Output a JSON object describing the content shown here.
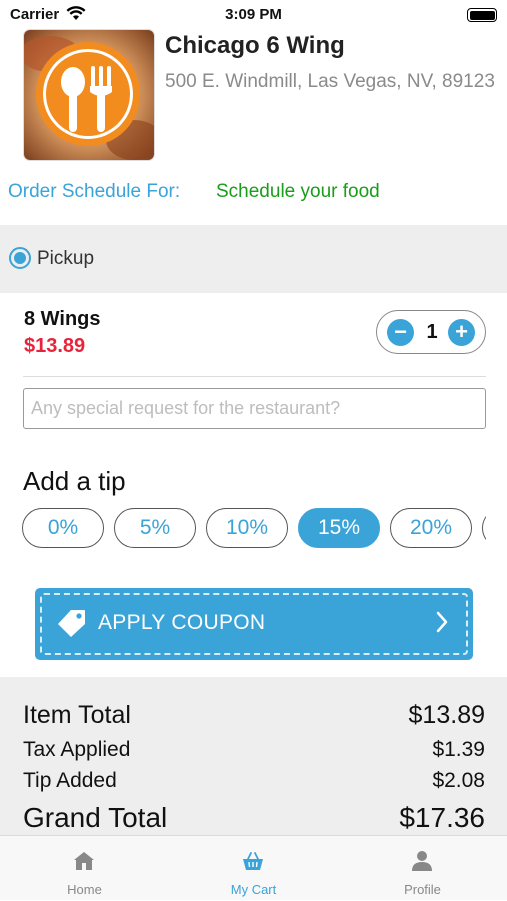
{
  "status_bar": {
    "carrier": "Carrier",
    "time": "3:09 PM"
  },
  "restaurant": {
    "name": "Chicago 6 Wing",
    "address": "500 E. Windmill, Las Vegas, NV, 89123"
  },
  "schedule": {
    "label": "Order Schedule For:",
    "value": "Schedule your food"
  },
  "delivery_option": {
    "label": "Pickup",
    "selected": true
  },
  "cart_item": {
    "name": "8 Wings",
    "price": "$13.89",
    "quantity": "1"
  },
  "special_request": {
    "placeholder": "Any special request for the restaurant?",
    "value": ""
  },
  "tip": {
    "title": "Add a tip",
    "options": [
      "0%",
      "5%",
      "10%",
      "15%",
      "20%"
    ],
    "selected": "15%"
  },
  "coupon": {
    "label": "APPLY COUPON"
  },
  "summary": {
    "item_total_label": "Item Total",
    "item_total": "$13.89",
    "tax_label": "Tax Applied",
    "tax": "$1.39",
    "tip_label": "Tip Added",
    "tip": "$2.08",
    "grand_total_label": "Grand Total",
    "grand_total": "$17.36"
  },
  "tabs": [
    {
      "label": "Home",
      "icon": "home-icon"
    },
    {
      "label": "My Cart",
      "icon": "basket-icon",
      "active": true
    },
    {
      "label": "Profile",
      "icon": "person-icon"
    }
  ],
  "colors": {
    "accent": "#3aa3d8",
    "price_red": "#e8243b",
    "schedule_green": "#1a9d1a"
  }
}
